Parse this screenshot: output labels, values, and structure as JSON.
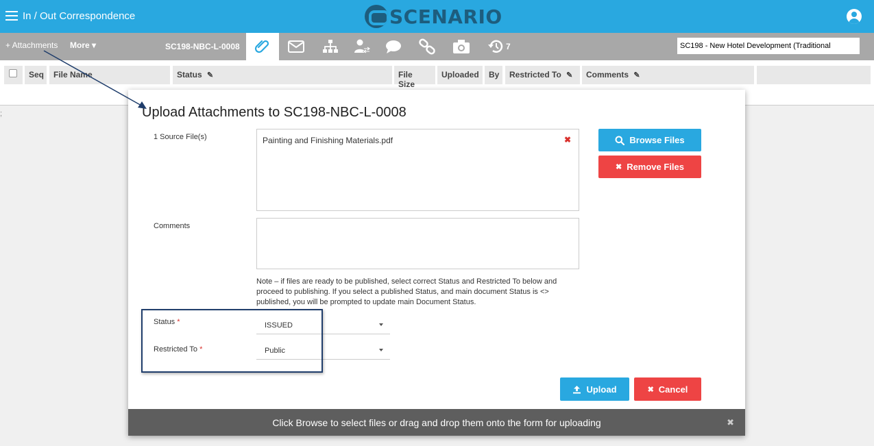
{
  "header": {
    "title": "In / Out Correspondence",
    "logo_text": "SCENARIO"
  },
  "toolbar": {
    "attachments_label": "+ Attachments",
    "more_label": "More ▾",
    "doc_number": "SC198-NBC-L-0008",
    "history_count": "7",
    "project": "SC198  -  New Hotel Development (Traditional"
  },
  "grid": {
    "columns": [
      "Seq",
      "File Name",
      "Status",
      "File Size",
      "Uploaded",
      "By",
      "Restricted To",
      "Comments"
    ],
    "stray": ";"
  },
  "modal": {
    "title": "Upload Attachments to SC198-NBC-L-0008",
    "source_label": "1 Source File(s)",
    "file_name": "Painting and Finishing Materials.pdf",
    "remove_glyph": "✖",
    "browse_label": "Browse Files",
    "remove_label": "Remove Files",
    "comments_label": "Comments",
    "note": "Note – if files are ready to be published, select correct Status and Restricted To below and proceed to publishing. If you select a published Status, and main document Status is <> published, you will be prompted to update main Document Status.",
    "status_label": "Status",
    "status_value": "ISSUED",
    "restricted_label": "Restricted To",
    "restricted_value": "Public",
    "required_mark": "*",
    "upload_label": "Upload",
    "cancel_label": "Cancel",
    "footer_text": "Click Browse to select files or drag and drop them onto the form for uploading",
    "footer_close": "✖"
  },
  "colors": {
    "primary": "#29a8e0",
    "danger": "#ee4444",
    "toolbar": "#a8a8a8",
    "footer": "#5e5e5e",
    "annotation": "#1f3d6b"
  },
  "icons": [
    "menu-icon",
    "user-icon",
    "paperclip-icon",
    "envelope-icon",
    "hierarchy-icon",
    "user-transfer-icon",
    "comment-icon",
    "link-icon",
    "camera-icon",
    "history-icon",
    "search-icon",
    "times-icon",
    "upload-icon",
    "caret-down-icon"
  ]
}
